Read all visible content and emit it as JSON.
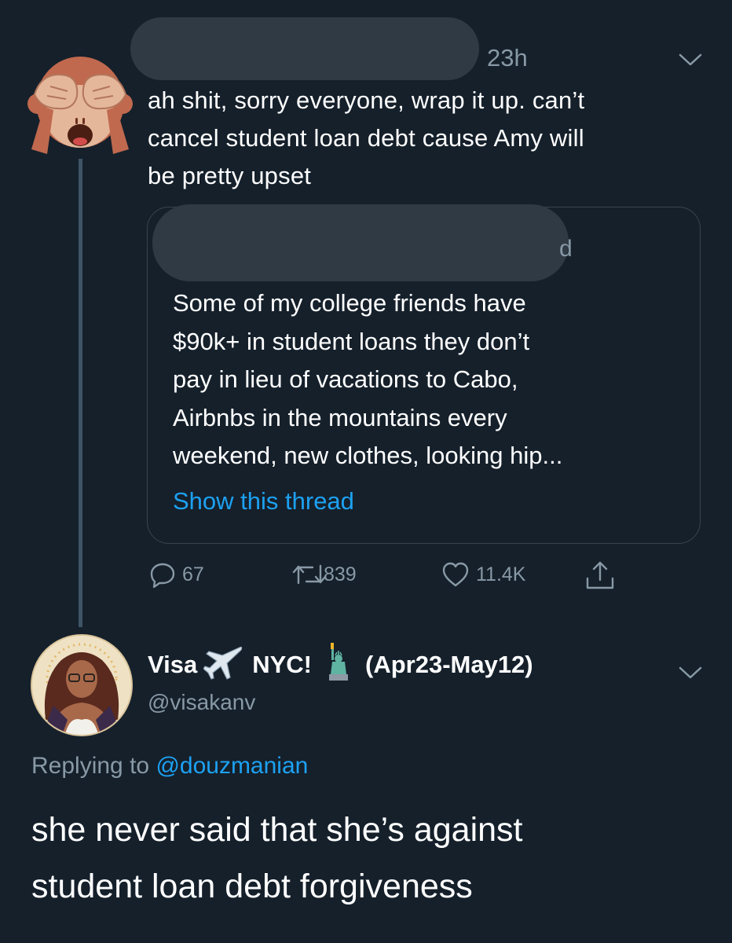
{
  "tweet": {
    "timestamp": "23h",
    "text_lines": [
      "ah shit, sorry everyone, wrap it up. can’t",
      "cancel student loan debt cause Amy will",
      "be pretty upset"
    ],
    "avatar_icon": "see-no-evil-monkey-icon",
    "menu_icon": "chevron-down-icon",
    "quote": {
      "partial_char": "d",
      "text_lines": [
        "Some of my college friends have",
        "$90k+ in student loans they don’t",
        "pay in lieu of vacations to Cabo,",
        "Airbnbs in the mountains every",
        "weekend, new clothes, looking hip..."
      ],
      "show_thread": "Show this thread"
    },
    "actions": {
      "replies": "67",
      "retweets": "839",
      "likes": "11.4K"
    }
  },
  "reply": {
    "name_part1": "Visa",
    "name_part2": "NYC!",
    "name_part3": "(Apr23-May12)",
    "name_emojis": [
      "airplane-icon",
      "statue-of-liberty-icon"
    ],
    "handle": "@visakanv",
    "replying_label": "Replying to",
    "replying_to": "@douzmanian",
    "text_lines": [
      "she never said that she’s against",
      "student loan debt forgiveness"
    ]
  },
  "colors": {
    "background": "#15202b",
    "muted": "#8899a6",
    "link": "#1da1f2",
    "border": "#38444d"
  }
}
